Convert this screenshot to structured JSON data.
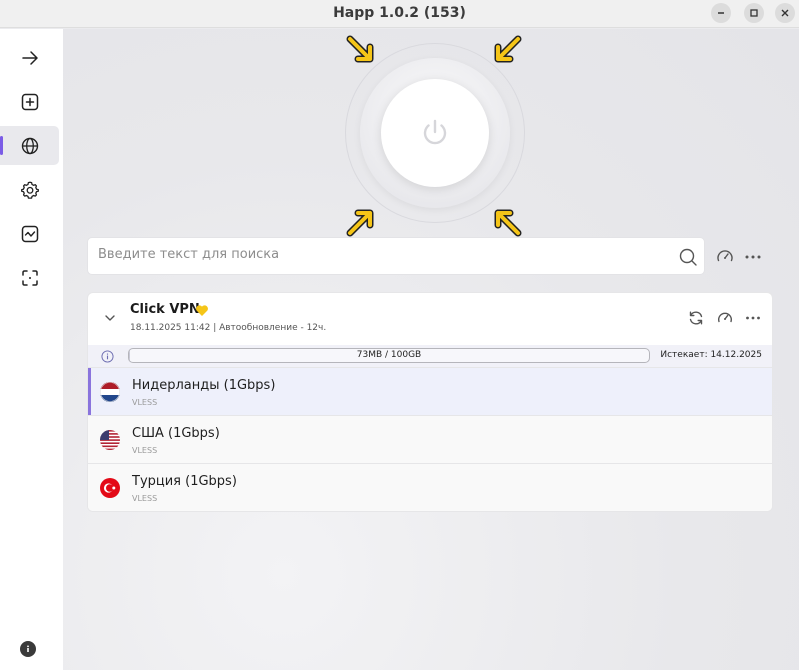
{
  "window": {
    "title": "Happ 1.0.2 (153)"
  },
  "sidebar": {
    "items": [
      {
        "icon": "arrow-right-icon"
      },
      {
        "icon": "plus-square-icon"
      },
      {
        "icon": "globe-icon",
        "active": true
      },
      {
        "icon": "gear-icon"
      },
      {
        "icon": "activity-chart-icon"
      },
      {
        "icon": "scan-frame-icon"
      }
    ],
    "footer_icon": "info-icon"
  },
  "search": {
    "placeholder": "Введите текст для поиска"
  },
  "subscription": {
    "name": "Click VPN",
    "emoji": "yellow-heart-icon",
    "meta": "18.11.2025 11:42 | Автообновление - 12ч.",
    "usage_text": "73MB / 100GB",
    "usage_fraction": 0.0007,
    "expires": "Истекает: 14.12.2025"
  },
  "servers": [
    {
      "name": "Нидерланды (1Gbps)",
      "protocol": "VLESS",
      "flag": "netherlands-flag-icon",
      "active": true
    },
    {
      "name": "США (1Gbps)",
      "protocol": "VLESS",
      "flag": "usa-flag-icon",
      "active": false
    },
    {
      "name": "Турция (1Gbps)",
      "protocol": "VLESS",
      "flag": "turkey-flag-icon",
      "active": false
    }
  ],
  "colors": {
    "accent": "#7b5ce6",
    "arrow": "#f5c518"
  }
}
